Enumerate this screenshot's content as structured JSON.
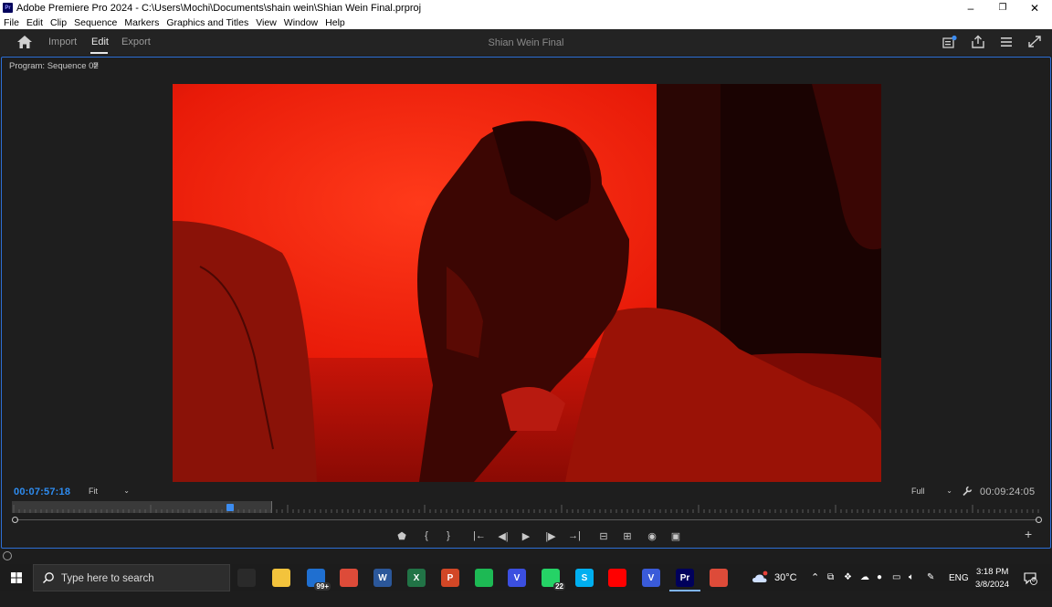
{
  "window": {
    "title": "Adobe Premiere Pro 2024 - C:\\Users\\Mochi\\Documents\\shain wein\\Shian Wein Final.prproj",
    "app_badge": "Pr",
    "controls": {
      "minimize": "–",
      "restore": "❐",
      "close": "✕"
    }
  },
  "menu": [
    "File",
    "Edit",
    "Clip",
    "Sequence",
    "Markers",
    "Graphics and Titles",
    "View",
    "Window",
    "Help"
  ],
  "header": {
    "tabs": {
      "import": "Import",
      "edit": "Edit",
      "export": "Export"
    },
    "active_tab": "Edit",
    "project_title": "Shian Wein Final",
    "right_icons": [
      "quick-export-icon",
      "share-icon",
      "workspaces-menu-icon",
      "fullscreen-icon"
    ]
  },
  "program_monitor": {
    "title": "Program: Sequence 02",
    "menu_glyph": "≡",
    "current_timecode": "00:07:57:18",
    "zoom": "Fit",
    "resolution": "Full",
    "duration": "00:09:24:05",
    "playhead_position_fraction": 0.21
  },
  "transport": {
    "buttons": [
      {
        "name": "add-marker-button",
        "glyph": "⬟"
      },
      {
        "name": "mark-in-button",
        "glyph": "{"
      },
      {
        "name": "mark-out-button",
        "glyph": "}"
      },
      {
        "name": "go-to-in-button",
        "glyph": "|←"
      },
      {
        "name": "step-back-button",
        "glyph": "◀|"
      },
      {
        "name": "play-button",
        "glyph": "▶"
      },
      {
        "name": "step-forward-button",
        "glyph": "|▶"
      },
      {
        "name": "go-to-out-button",
        "glyph": "→|"
      },
      {
        "name": "lift-button",
        "glyph": "⊟"
      },
      {
        "name": "extract-button",
        "glyph": "⊞"
      },
      {
        "name": "export-frame-button",
        "glyph": "◉"
      },
      {
        "name": "comparison-view-button",
        "glyph": "▣"
      }
    ],
    "add_button": "+"
  },
  "taskbar": {
    "search_placeholder": "Type here to search",
    "apps": [
      {
        "name": "task-view",
        "label": "",
        "color": "#2a2a2a"
      },
      {
        "name": "file-explorer",
        "label": "",
        "color": "#f3c33c"
      },
      {
        "name": "mail",
        "label": "99+",
        "color": "#1f6fd0"
      },
      {
        "name": "chrome",
        "label": "",
        "color": "#dd4b39"
      },
      {
        "name": "word",
        "label": "W",
        "color": "#2b579a"
      },
      {
        "name": "excel",
        "label": "X",
        "color": "#217346"
      },
      {
        "name": "powerpoint",
        "label": "P",
        "color": "#d24726"
      },
      {
        "name": "spotify",
        "label": "",
        "color": "#1db954"
      },
      {
        "name": "vpn",
        "label": "V",
        "color": "#3b4fe0"
      },
      {
        "name": "whatsapp",
        "label": "22",
        "color": "#25d366"
      },
      {
        "name": "skype",
        "label": "S",
        "color": "#00aff0"
      },
      {
        "name": "youtube",
        "label": "",
        "color": "#ff0000"
      },
      {
        "name": "vegas",
        "label": "V",
        "color": "#3a5bd9"
      },
      {
        "name": "premiere",
        "label": "Pr",
        "color": "#00005b"
      },
      {
        "name": "chrome-2",
        "label": "",
        "color": "#dd4b39"
      }
    ],
    "weather": "30°C",
    "language": "ENG",
    "time": "3:18 PM",
    "date": "3/8/2024",
    "notifications": "8"
  }
}
